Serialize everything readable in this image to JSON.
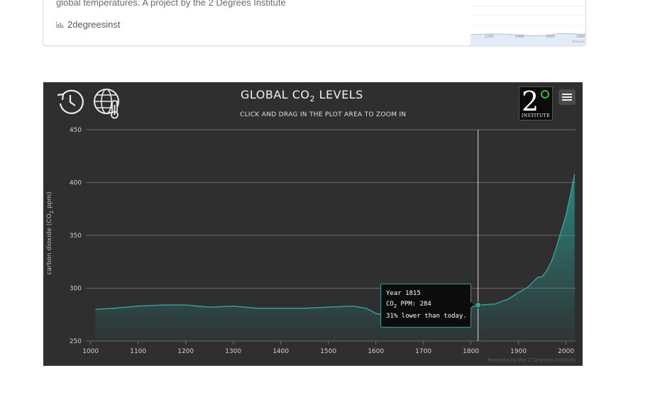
{
  "card": {
    "description": "global temperatures. A project by the 2 Degrees Institute",
    "username": "2degreesinst",
    "thumb_ticks": [
      "1200",
      "1400",
      "1600",
      "1800"
    ],
    "thumb_credit": "Powered"
  },
  "chart_toolbar": {
    "history_icon": "history-icon",
    "globe_icon": "globe-thermometer-icon",
    "menu_icon": "hamburger-menu-icon"
  },
  "logo": {
    "number": "2",
    "text": "INSTITUTE",
    "ring_color": "#2bbf3a"
  },
  "tooltip": {
    "year_line": "Year 1815",
    "co2_prefix": "CO",
    "co2_sub": "2",
    "co2_value": " PPM: 284",
    "compare_line": "31% lower than today."
  },
  "credits": "Powered by the 2 Degrees Institute",
  "colors": {
    "background": "#2f2f2f",
    "series": "#2aa39b",
    "grid": "#6a6a6a"
  },
  "chart_data": {
    "type": "area",
    "title_main": "GLOBAL CO",
    "title_sub": "2",
    "title_end": " LEVELS",
    "subtitle": "CLICK AND DRAG IN THE PLOT AREA TO ZOOM IN",
    "ylabel_main": "carbon dioxide (CO",
    "ylabel_sub": "2",
    "ylabel_end": " ppm)",
    "xlim": [
      990,
      2020
    ],
    "ylim": [
      250,
      450
    ],
    "xticks": [
      1000,
      1100,
      1200,
      1300,
      1400,
      1500,
      1600,
      1700,
      1800,
      1900,
      2000
    ],
    "yticks": [
      250,
      300,
      350,
      400,
      450
    ],
    "crosshair_x": 1815,
    "highlight": {
      "x": 1815,
      "y": 284
    },
    "series": [
      {
        "name": "CO2 ppm",
        "x": [
          1010,
          1050,
          1100,
          1150,
          1200,
          1250,
          1300,
          1350,
          1400,
          1450,
          1500,
          1550,
          1580,
          1600,
          1620,
          1650,
          1700,
          1750,
          1800,
          1815,
          1850,
          1880,
          1900,
          1920,
          1940,
          1950,
          1960,
          1970,
          1980,
          1990,
          2000,
          2010,
          2015,
          2018
        ],
        "y": [
          280,
          281,
          283,
          284,
          284,
          282,
          283,
          281,
          281,
          281,
          282,
          283,
          281,
          276,
          275,
          276,
          277,
          277,
          282,
          284,
          285,
          290,
          296,
          301,
          310,
          311,
          317,
          326,
          339,
          354,
          369,
          390,
          401,
          408
        ]
      }
    ]
  }
}
